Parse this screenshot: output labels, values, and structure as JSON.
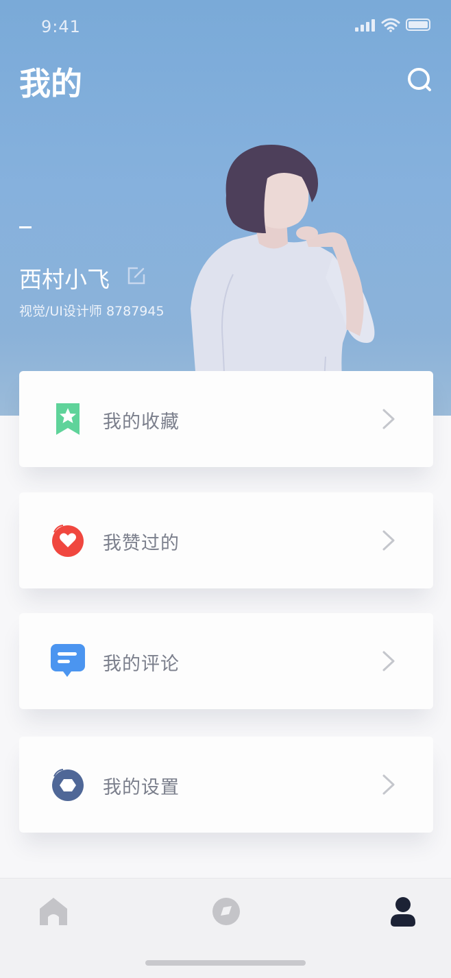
{
  "status_bar": {
    "time": "9:41"
  },
  "header": {
    "title": "我的"
  },
  "profile": {
    "name": "西村小飞",
    "description": "视觉/UI设计师 8787945"
  },
  "menu": [
    {
      "label": "我的收藏",
      "icon": "bookmark-star-icon",
      "color": "#5fd39a"
    },
    {
      "label": "我赞过的",
      "icon": "heart-icon",
      "color": "#f0473f"
    },
    {
      "label": "我的评论",
      "icon": "comment-icon",
      "color": "#4b95f0"
    },
    {
      "label": "我的设置",
      "icon": "settings-hexagon-icon",
      "color": "#4f6797"
    }
  ],
  "tabbar": {
    "tabs": [
      {
        "icon": "home-icon",
        "active": false
      },
      {
        "icon": "discover-icon",
        "active": false
      },
      {
        "icon": "profile-icon",
        "active": true
      }
    ],
    "active_color": "#1c2235",
    "inactive_color": "#c4c4c8"
  }
}
